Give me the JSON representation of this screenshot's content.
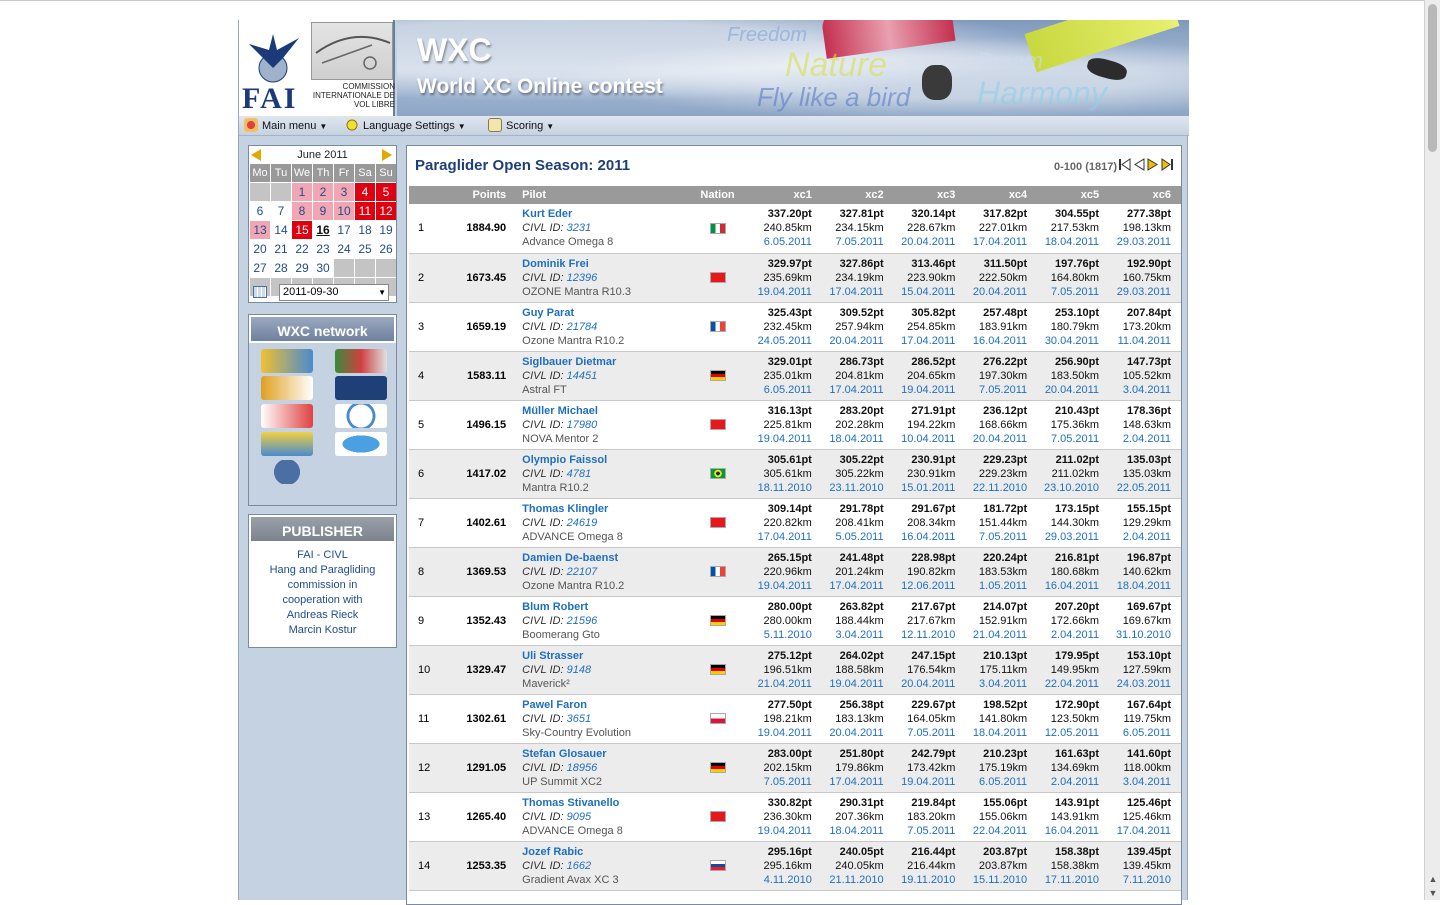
{
  "header": {
    "fai_text": "FAI",
    "civl_text": "COMMISSION INTERNATIONALE DE VOL LIBRE",
    "banner_title": "WXC",
    "banner_subtitle": "World XC Online contest",
    "banner_words": [
      "Freedom",
      "Nature",
      "Dream",
      "Fly like a bird",
      "Harmony"
    ]
  },
  "menubar": {
    "main_menu": "Main menu",
    "language": "Language Settings",
    "scoring": "Scoring"
  },
  "calendar": {
    "month": "June 2011",
    "dow": [
      "Mo",
      "Tu",
      "We",
      "Th",
      "Fr",
      "Sa",
      "Su"
    ],
    "date_value": "2011-09-30"
  },
  "network": {
    "title": "WXC network",
    "logos": [
      "paragliding-forum",
      "xcc",
      "xc-contest",
      "dhv-xc",
      "hcontest-schweiz",
      "xc-online",
      "xc-australia",
      "ffvl",
      "civl-globe"
    ]
  },
  "publisher": {
    "title": "PUBLISHER",
    "lines": [
      "FAI - CIVL",
      "Hang and Paragliding",
      "commission in",
      "cooperation with",
      "Andreas Rieck",
      "Marcin Kostur"
    ]
  },
  "main": {
    "title": "Paraglider Open  Season: 2011",
    "range": "0-100 (1817)",
    "columns": [
      "Points",
      "Pilot",
      "Nation",
      "xc1",
      "xc2",
      "xc3",
      "xc4",
      "xc5",
      "xc6"
    ],
    "rows": [
      {
        "rank": "1",
        "points": "1884.90",
        "name": "Kurt Eder",
        "civl": "3231",
        "glider": "Advance Omega 8",
        "flag": "italy",
        "xc": [
          [
            "337.20pt",
            "240.85km",
            "6.05.2011"
          ],
          [
            "327.81pt",
            "234.15km",
            "7.05.2011"
          ],
          [
            "320.14pt",
            "228.67km",
            "20.04.2011"
          ],
          [
            "317.82pt",
            "227.01km",
            "17.04.2011"
          ],
          [
            "304.55pt",
            "217.53km",
            "18.04.2011"
          ],
          [
            "277.38pt",
            "198.13km",
            "29.03.2011"
          ]
        ]
      },
      {
        "rank": "2",
        "points": "1673.45",
        "name": "Dominik Frei",
        "civl": "12396",
        "glider": "OZONE Mantra R10.3",
        "flag": "switzerland",
        "xc": [
          [
            "329.97pt",
            "235.69km",
            "19.04.2011"
          ],
          [
            "327.86pt",
            "234.19km",
            "17.04.2011"
          ],
          [
            "313.46pt",
            "223.90km",
            "15.04.2011"
          ],
          [
            "311.50pt",
            "222.50km",
            "20.04.2011"
          ],
          [
            "197.76pt",
            "164.80km",
            "7.05.2011"
          ],
          [
            "192.90pt",
            "160.75km",
            "29.03.2011"
          ]
        ]
      },
      {
        "rank": "3",
        "points": "1659.19",
        "name": "Guy Parat",
        "civl": "21784",
        "glider": "Ozone Mantra R10.2",
        "flag": "france",
        "xc": [
          [
            "325.43pt",
            "232.45km",
            "24.05.2011"
          ],
          [
            "309.52pt",
            "257.94km",
            "20.04.2011"
          ],
          [
            "305.82pt",
            "254.85km",
            "17.04.2011"
          ],
          [
            "257.48pt",
            "183.91km",
            "16.04.2011"
          ],
          [
            "253.10pt",
            "180.79km",
            "30.04.2011"
          ],
          [
            "207.84pt",
            "173.20km",
            "11.04.2011"
          ]
        ]
      },
      {
        "rank": "4",
        "points": "1583.11",
        "name": "Siglbauer Dietmar",
        "civl": "14451",
        "glider": "Astral FT",
        "flag": "germany",
        "xc": [
          [
            "329.01pt",
            "235.01km",
            "6.05.2011"
          ],
          [
            "286.73pt",
            "204.81km",
            "17.04.2011"
          ],
          [
            "286.52pt",
            "204.65km",
            "19.04.2011"
          ],
          [
            "276.22pt",
            "197.30km",
            "7.05.2011"
          ],
          [
            "256.90pt",
            "183.50km",
            "20.04.2011"
          ],
          [
            "147.73pt",
            "105.52km",
            "3.04.2011"
          ]
        ]
      },
      {
        "rank": "5",
        "points": "1496.15",
        "name": "Müller Michael",
        "civl": "17980",
        "glider": "NOVA Mentor 2",
        "flag": "switzerland",
        "xc": [
          [
            "316.13pt",
            "225.81km",
            "19.04.2011"
          ],
          [
            "283.20pt",
            "202.28km",
            "18.04.2011"
          ],
          [
            "271.91pt",
            "194.22km",
            "10.04.2011"
          ],
          [
            "236.12pt",
            "168.66km",
            "20.04.2011"
          ],
          [
            "210.43pt",
            "175.36km",
            "7.05.2011"
          ],
          [
            "178.36pt",
            "148.63km",
            "2.04.2011"
          ]
        ]
      },
      {
        "rank": "6",
        "points": "1417.02",
        "name": "Olympio Faissol",
        "civl": "4781",
        "glider": "Mantra R10.2",
        "flag": "brazil",
        "xc": [
          [
            "305.61pt",
            "305.61km",
            "18.11.2010"
          ],
          [
            "305.22pt",
            "305.22km",
            "23.11.2010"
          ],
          [
            "230.91pt",
            "230.91km",
            "15.01.2011"
          ],
          [
            "229.23pt",
            "229.23km",
            "22.11.2010"
          ],
          [
            "211.02pt",
            "211.02km",
            "23.10.2010"
          ],
          [
            "135.03pt",
            "135.03km",
            "22.05.2011"
          ]
        ]
      },
      {
        "rank": "7",
        "points": "1402.61",
        "name": "Thomas Klingler",
        "civl": "24619",
        "glider": "ADVANCE Omega 8",
        "flag": "switzerland",
        "xc": [
          [
            "309.14pt",
            "220.82km",
            "17.04.2011"
          ],
          [
            "291.78pt",
            "208.41km",
            "5.05.2011"
          ],
          [
            "291.67pt",
            "208.34km",
            "16.04.2011"
          ],
          [
            "181.72pt",
            "151.44km",
            "7.05.2011"
          ],
          [
            "173.15pt",
            "144.30km",
            "29.03.2011"
          ],
          [
            "155.15pt",
            "129.29km",
            "2.04.2011"
          ]
        ]
      },
      {
        "rank": "8",
        "points": "1369.53",
        "name": "Damien De-baenst",
        "civl": "22107",
        "glider": "Ozone Mantra R10.2",
        "flag": "france",
        "xc": [
          [
            "265.15pt",
            "220.96km",
            "19.04.2011"
          ],
          [
            "241.48pt",
            "201.24km",
            "17.04.2011"
          ],
          [
            "228.98pt",
            "190.82km",
            "12.06.2011"
          ],
          [
            "220.24pt",
            "183.53km",
            "1.05.2011"
          ],
          [
            "216.81pt",
            "180.68km",
            "16.04.2011"
          ],
          [
            "196.87pt",
            "140.62km",
            "18.04.2011"
          ]
        ]
      },
      {
        "rank": "9",
        "points": "1352.43",
        "name": "Blum Robert",
        "civl": "21596",
        "glider": "Boomerang Gto",
        "flag": "germany",
        "xc": [
          [
            "280.00pt",
            "280.00km",
            "5.11.2010"
          ],
          [
            "263.82pt",
            "188.44km",
            "3.04.2011"
          ],
          [
            "217.67pt",
            "217.67km",
            "12.11.2010"
          ],
          [
            "214.07pt",
            "152.91km",
            "21.04.2011"
          ],
          [
            "207.20pt",
            "172.66km",
            "2.04.2011"
          ],
          [
            "169.67pt",
            "169.67km",
            "31.10.2010"
          ]
        ]
      },
      {
        "rank": "10",
        "points": "1329.47",
        "name": "Uli Strasser",
        "civl": "9148",
        "glider": "Maverick²",
        "flag": "germany",
        "xc": [
          [
            "275.12pt",
            "196.51km",
            "21.04.2011"
          ],
          [
            "264.02pt",
            "188.58km",
            "19.04.2011"
          ],
          [
            "247.15pt",
            "176.54km",
            "20.04.2011"
          ],
          [
            "210.13pt",
            "175.11km",
            "3.04.2011"
          ],
          [
            "179.95pt",
            "149.95km",
            "22.04.2011"
          ],
          [
            "153.10pt",
            "127.59km",
            "24.03.2011"
          ]
        ]
      },
      {
        "rank": "11",
        "points": "1302.61",
        "name": "Pawel Faron",
        "civl": "3651",
        "glider": "Sky-Country Evolution",
        "flag": "poland",
        "xc": [
          [
            "277.50pt",
            "198.21km",
            "19.04.2011"
          ],
          [
            "256.38pt",
            "183.13km",
            "20.04.2011"
          ],
          [
            "229.67pt",
            "164.05km",
            "7.05.2011"
          ],
          [
            "198.52pt",
            "141.80km",
            "18.04.2011"
          ],
          [
            "172.90pt",
            "123.50km",
            "12.05.2011"
          ],
          [
            "167.64pt",
            "119.75km",
            "6.05.2011"
          ]
        ]
      },
      {
        "rank": "12",
        "points": "1291.05",
        "name": "Stefan Glosauer",
        "civl": "18956",
        "glider": "UP Summit XC2",
        "flag": "germany",
        "xc": [
          [
            "283.00pt",
            "202.15km",
            "7.05.2011"
          ],
          [
            "251.80pt",
            "179.86km",
            "17.04.2011"
          ],
          [
            "242.79pt",
            "173.42km",
            "19.04.2011"
          ],
          [
            "210.23pt",
            "175.19km",
            "6.05.2011"
          ],
          [
            "161.63pt",
            "134.69km",
            "2.04.2011"
          ],
          [
            "141.60pt",
            "118.00km",
            "3.04.2011"
          ]
        ]
      },
      {
        "rank": "13",
        "points": "1265.40",
        "name": "Thomas Stivanello",
        "civl": "9095",
        "glider": "ADVANCE Omega 8",
        "flag": "switzerland",
        "xc": [
          [
            "330.82pt",
            "236.30km",
            "19.04.2011"
          ],
          [
            "290.31pt",
            "207.36km",
            "18.04.2011"
          ],
          [
            "219.84pt",
            "183.20km",
            "7.05.2011"
          ],
          [
            "155.06pt",
            "155.06km",
            "22.04.2011"
          ],
          [
            "143.91pt",
            "143.91km",
            "16.04.2011"
          ],
          [
            "125.46pt",
            "125.46km",
            "17.04.2011"
          ]
        ]
      },
      {
        "rank": "14",
        "points": "1253.35",
        "name": "Jozef Rabic",
        "civl": "1662",
        "glider": "Gradient Avax XC 3",
        "flag": "slovakia",
        "xc": [
          [
            "295.16pt",
            "295.16km",
            "4.11.2010"
          ],
          [
            "240.05pt",
            "240.05km",
            "21.11.2010"
          ],
          [
            "216.44pt",
            "216.44km",
            "19.11.2010"
          ],
          [
            "203.87pt",
            "203.87km",
            "15.11.2010"
          ],
          [
            "158.38pt",
            "158.38km",
            "17.11.2010"
          ],
          [
            "139.45pt",
            "139.45km",
            "7.11.2010"
          ]
        ]
      }
    ]
  },
  "colors": {
    "link": "#1f6fbf",
    "title": "#1f3f78",
    "page_bg": "#c5d2e2",
    "header_gray": "#9a9a9a"
  }
}
